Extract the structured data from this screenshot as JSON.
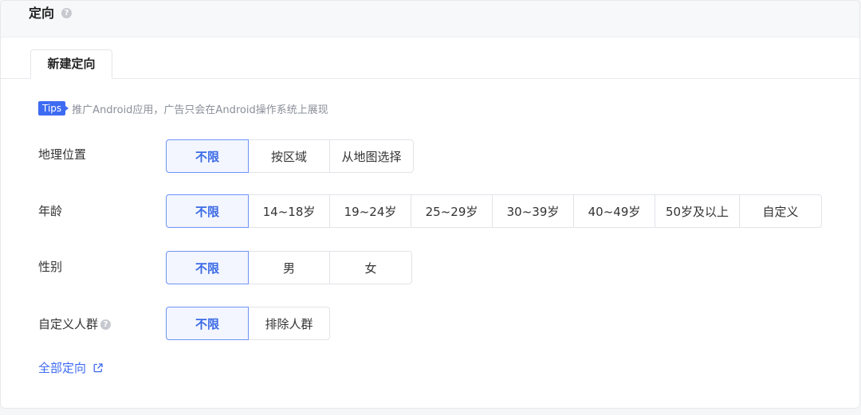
{
  "header": {
    "title": "定向",
    "help": "?"
  },
  "tabs": [
    {
      "label": "新建定向",
      "active": true
    }
  ],
  "tips": {
    "badge": "Tips",
    "text": "推广Android应用，广告只会在Android操作系统上展现"
  },
  "geo": {
    "label": "地理位置",
    "options": [
      "不限",
      "按区域",
      "从地图选择"
    ],
    "selected": "不限"
  },
  "age": {
    "label": "年龄",
    "options": [
      "不限",
      "14~18岁",
      "19~24岁",
      "25~29岁",
      "30~39岁",
      "40~49岁",
      "50岁及以上",
      "自定义"
    ],
    "selected": "不限"
  },
  "gender": {
    "label": "性别",
    "options": [
      "不限",
      "男",
      "女"
    ],
    "selected": "不限"
  },
  "audience": {
    "label": "自定义人群",
    "help": "?",
    "options": [
      "不限",
      "排除人群"
    ],
    "selected": "不限"
  },
  "footer_link": {
    "label": "全部定向",
    "icon": "external-link-icon"
  },
  "colors": {
    "accent": "#3d6bf2",
    "active_bg": "#f3f6ff",
    "active_border": "#6d93f5"
  }
}
